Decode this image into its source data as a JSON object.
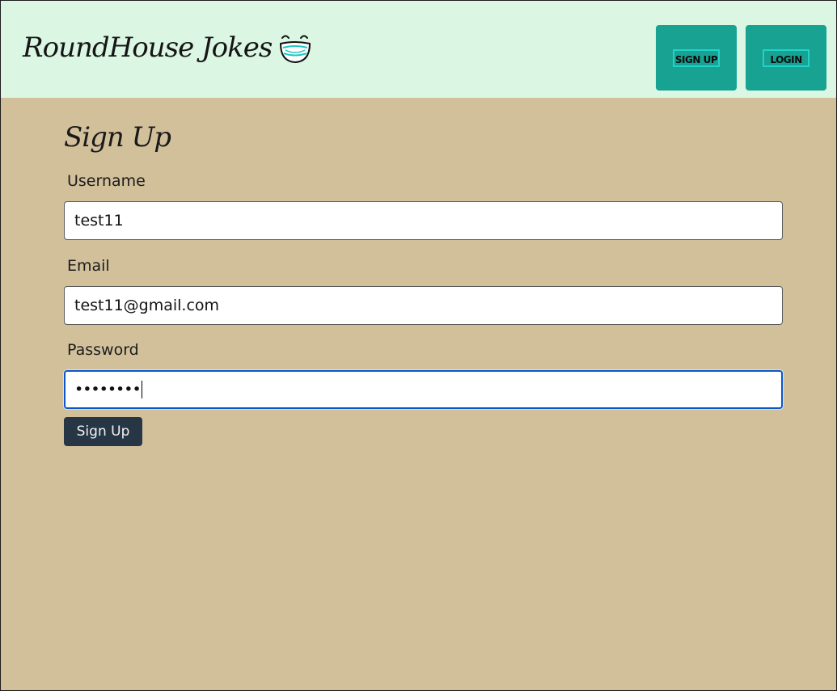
{
  "header": {
    "brand_title": "RoundHouse Jokes",
    "logo_icon": "laughing-face-icon",
    "nav": {
      "signup_label": "SIGN UP",
      "login_label": "LOGIN"
    }
  },
  "form": {
    "title": "Sign Up",
    "fields": [
      {
        "label": "Username",
        "value": "test11"
      },
      {
        "label": "Email",
        "value": "test11@gmail.com"
      },
      {
        "label": "Password",
        "value": "••••••••"
      }
    ],
    "submit_label": "Sign Up"
  },
  "colors": {
    "header_bg": "#dbf6e3",
    "page_bg": "#d2c09b",
    "nav_button": "#17a292",
    "nav_button_border": "#23d2c8",
    "submit_button": "#263645",
    "focus_ring": "#0b57c7"
  }
}
